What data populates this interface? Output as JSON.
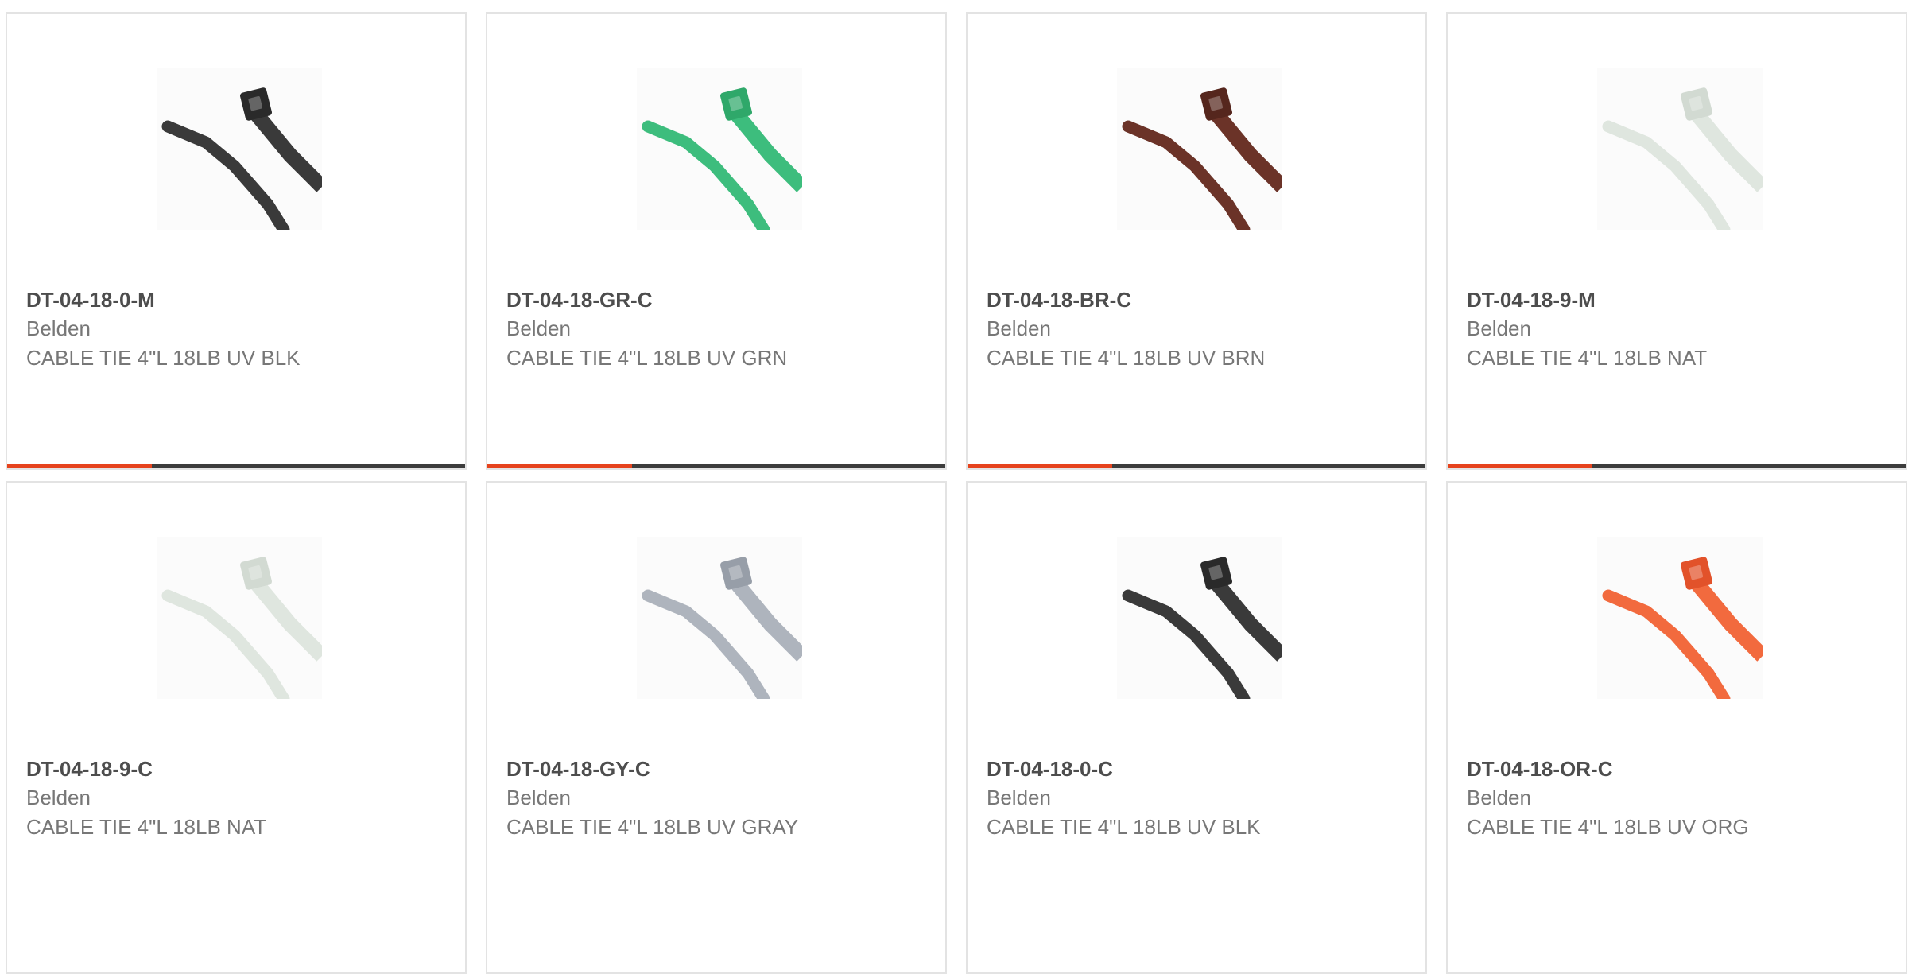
{
  "colors": {
    "accent_bar": "#e6431d",
    "dark_bar": "#3c3c3c",
    "card_border": "#e3e3e3",
    "part_number_text": "#4d4d4d",
    "secondary_text": "#777777"
  },
  "products": [
    {
      "part_number": "DT-04-18-0-M",
      "manufacturer": "Belden",
      "description": "CABLE TIE 4\"L 18LB UV BLK",
      "image": "black-cable-tie",
      "tie_color": "#3a3a3a",
      "head_color": "#2a2a2a"
    },
    {
      "part_number": "DT-04-18-GR-C",
      "manufacturer": "Belden",
      "description": "CABLE TIE 4\"L 18LB UV GRN",
      "image": "green-cable-tie",
      "tie_color": "#3dbd7d",
      "head_color": "#2fa86a"
    },
    {
      "part_number": "DT-04-18-BR-C",
      "manufacturer": "Belden",
      "description": "CABLE TIE 4\"L 18LB UV BRN",
      "image": "brown-cable-tie",
      "tie_color": "#6b3328",
      "head_color": "#55261d"
    },
    {
      "part_number": "DT-04-18-9-M",
      "manufacturer": "Belden",
      "description": "CABLE TIE 4\"L 18LB NAT",
      "image": "natural-cable-tie",
      "tie_color": "#dfe6df",
      "head_color": "#d2dad2"
    },
    {
      "part_number": "DT-04-18-9-C",
      "manufacturer": "Belden",
      "description": "CABLE TIE 4\"L 18LB NAT",
      "image": "natural-cable-tie",
      "tie_color": "#dfe6df",
      "head_color": "#d2dad2"
    },
    {
      "part_number": "DT-04-18-GY-C",
      "manufacturer": "Belden",
      "description": "CABLE TIE 4\"L 18LB UV GRAY",
      "image": "gray-cable-tie",
      "tie_color": "#aeb4bd",
      "head_color": "#979ea8"
    },
    {
      "part_number": "DT-04-18-0-C",
      "manufacturer": "Belden",
      "description": "CABLE TIE 4\"L 18LB UV BLK",
      "image": "black-cable-tie",
      "tie_color": "#3a3a3a",
      "head_color": "#2a2a2a"
    },
    {
      "part_number": "DT-04-18-OR-C",
      "manufacturer": "Belden",
      "description": "CABLE TIE 4\"L 18LB UV ORG",
      "image": "orange-cable-tie",
      "tie_color": "#f26a3e",
      "head_color": "#e2522a"
    }
  ]
}
